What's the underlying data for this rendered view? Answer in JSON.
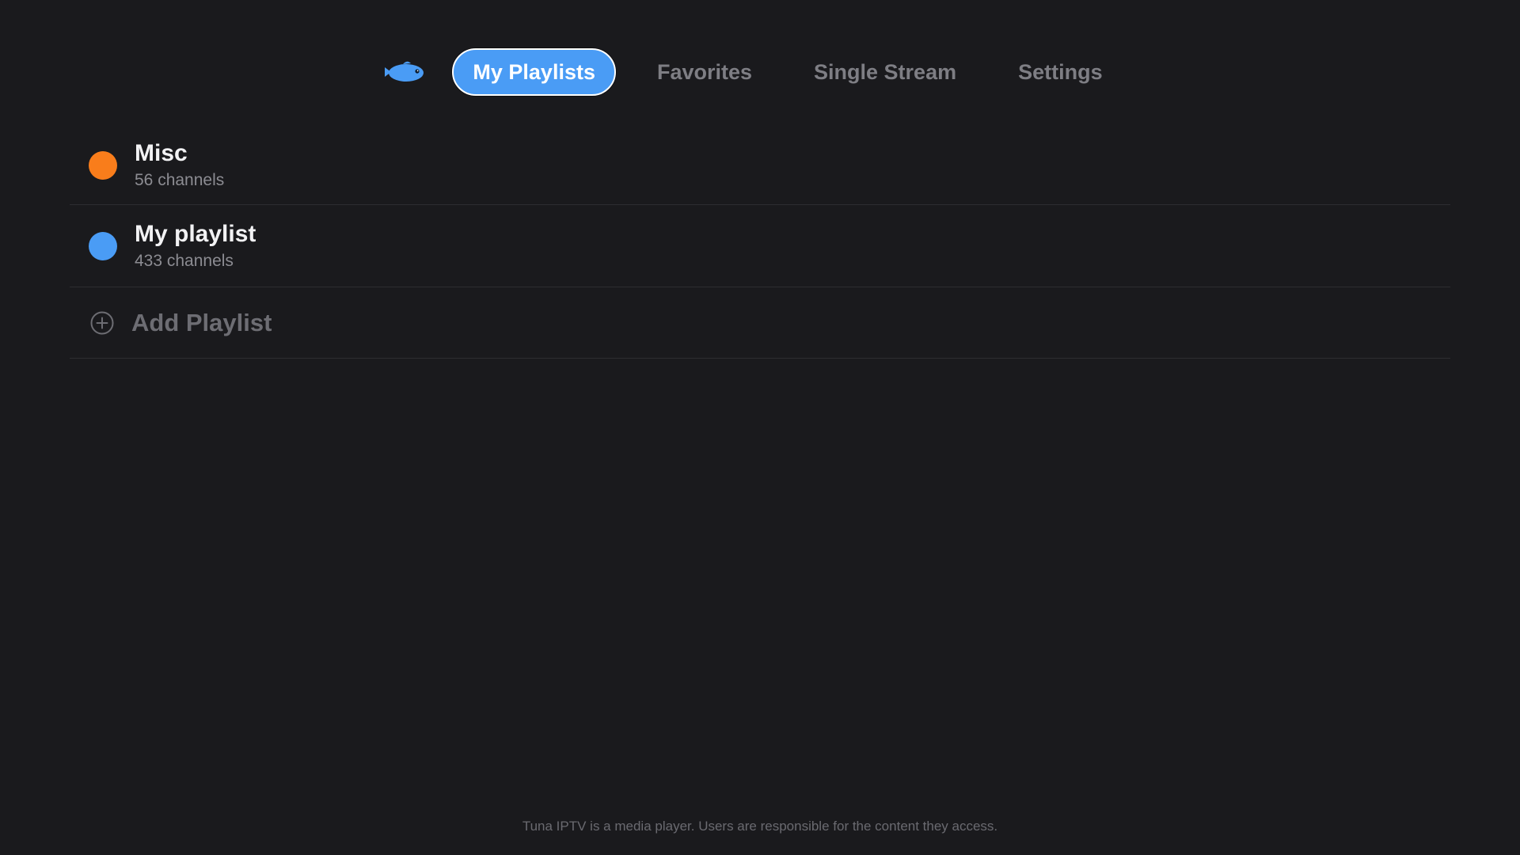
{
  "app": {
    "logo_icon": "tuna-fish-icon",
    "accent_color": "#4a9cf5"
  },
  "nav": {
    "tabs": [
      {
        "label": "My Playlists",
        "active": true
      },
      {
        "label": "Favorites",
        "active": false
      },
      {
        "label": "Single Stream",
        "active": false
      },
      {
        "label": "Settings",
        "active": false
      }
    ]
  },
  "playlists": [
    {
      "name": "Misc",
      "count": "56 channels",
      "color": "#f97d1b"
    },
    {
      "name": "My playlist",
      "count": "433 channels",
      "color": "#4a9cf5"
    }
  ],
  "add_playlist": {
    "label": "Add Playlist",
    "icon": "plus-circle-icon"
  },
  "footer": {
    "disclaimer": "Tuna IPTV is a media player. Users are responsible for the content they access."
  }
}
